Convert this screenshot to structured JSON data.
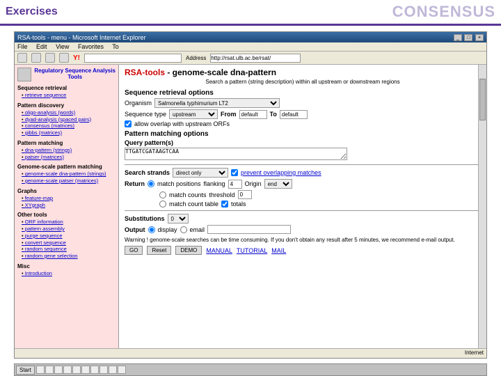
{
  "slide": {
    "left": "Exercises",
    "right": "CONSENSUS"
  },
  "window": {
    "title": "RSA-tools - menu - Microsoft Internet Explorer",
    "menu": [
      "File",
      "Edit",
      "View",
      "Favorites",
      "To"
    ],
    "yahoo": "Y!",
    "addr_label": "Address",
    "addr_value": "http://rsat.ulb.ac.be/rsat/"
  },
  "sidebar": {
    "brand": "Regulatory Sequence Analysis Tools",
    "sections": [
      {
        "title": "Sequence retrieval",
        "items": [
          "retrieve sequence"
        ]
      },
      {
        "title": "Pattern discovery",
        "items": [
          "oligo-analysis (words)",
          "dyad-analysis (spaced pairs)",
          "consensus (matrices)",
          "gibbs (matrices)"
        ]
      },
      {
        "title": "Pattern matching",
        "items": [
          "dna-pattern (strings)",
          "patser (matrices)"
        ]
      },
      {
        "title": "Genome-scale pattern matching",
        "items": [
          "genome-scale dna-pattern (strings)",
          "genome-scale patser (matrices)"
        ]
      },
      {
        "title": "Graphs",
        "items": [
          "feature-map",
          "XYgraph"
        ]
      },
      {
        "title": "Other tools",
        "items": [
          "ORF information",
          "pattern assembly",
          "purge sequence",
          "convert sequence",
          "random sequence",
          "random gene selection"
        ]
      },
      {
        "title": "Misc",
        "items": [
          "Introduction"
        ]
      }
    ]
  },
  "main": {
    "title_prefix": "RSA-tools",
    "title_rest": " - genome-scale dna-pattern",
    "subtitle": "Search a pattern (string description) within all upstream or downstream regions",
    "seq_header": "Sequence retrieval options",
    "organism_label": "Organism",
    "organism_value": "Salmonella typhimurium LT2",
    "seqtype_label": "Sequence type",
    "seqtype_value": "upstream",
    "from_label": "From",
    "from_value": "default",
    "to_label": "To",
    "to_value": "default",
    "overlap_label": "allow overlap with upstream ORFs",
    "pattern_header": "Pattern matching options",
    "query_label": "Query pattern(s)",
    "query_value": "TTGATCGATAAGTCAA",
    "strands_label": "Search strands",
    "strands_value": "direct only",
    "prevent_label": "prevent overlapping matches",
    "return_label": "Return",
    "return_opts": [
      "match positions",
      "match counts",
      "match count table"
    ],
    "flanking_label": "flanking",
    "flanking_value": "4",
    "origin_label": "Origin",
    "origin_value": "end",
    "threshold_label": "threshold",
    "threshold_value": "0",
    "totals_label": "totals",
    "subs_label": "Substitutions",
    "subs_value": "0",
    "output_label": "Output",
    "output_opts": [
      "display",
      "email"
    ],
    "warning": "Warning ! genome-scale searches can be time consuming. If you don't obtain any result after 5 minutes, we recommend e-mail output.",
    "buttons": {
      "go": "GO",
      "reset": "Reset",
      "demo": "DEMO"
    },
    "links": [
      "MANUAL",
      "TUTORIAL",
      "MAIL"
    ]
  },
  "statusbar": {
    "left": "",
    "right": "Internet"
  },
  "taskbar": {
    "start": "Start",
    "clock": ""
  }
}
